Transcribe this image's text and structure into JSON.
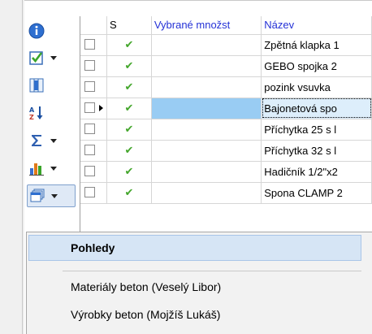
{
  "toolbar": {
    "buttons": [
      {
        "icon": "info-icon",
        "has_dropdown": false
      },
      {
        "icon": "checkbox-select-icon",
        "has_dropdown": true
      },
      {
        "icon": "columns-icon",
        "has_dropdown": false
      },
      {
        "icon": "sort-az-icon",
        "has_dropdown": false
      },
      {
        "icon": "sum-icon",
        "has_dropdown": true
      },
      {
        "icon": "bar-chart-icon",
        "has_dropdown": true
      },
      {
        "icon": "views-icon",
        "has_dropdown": true,
        "pressed": true
      }
    ]
  },
  "grid": {
    "columns": [
      "",
      "S",
      "Vybrané množst",
      "Název"
    ],
    "rows": [
      {
        "status": "✔",
        "qty": "",
        "name": "Zpětná klapka 1",
        "selected": false
      },
      {
        "status": "✔",
        "qty": "",
        "name": "GEBO spojka 2",
        "selected": false
      },
      {
        "status": "✔",
        "qty": "",
        "name": "pozink vsuvka",
        "selected": false
      },
      {
        "status": "✔",
        "qty": "",
        "name": "Bajonetová spo",
        "selected": true
      },
      {
        "status": "✔",
        "qty": "",
        "name": "Příchytka 25 s l",
        "selected": false
      },
      {
        "status": "✔",
        "qty": "",
        "name": "Příchytka 32 s l",
        "selected": false
      },
      {
        "status": "✔",
        "qty": "",
        "name": "Hadičník 1/2\"x2",
        "selected": false
      },
      {
        "status": "✔",
        "qty": "",
        "name": "Spona CLAMP 2",
        "selected": false
      }
    ]
  },
  "menu": {
    "header": "Pohledy",
    "items": [
      "Materiály beton (Veselý Libor)",
      "Výrobky beton (Mojžíš Lukáš)"
    ]
  },
  "colors": {
    "header_blue": "#2431d6",
    "check_green": "#43a62b",
    "selection": "#99ccf3",
    "menu_highlight": "#d6e5f5"
  }
}
